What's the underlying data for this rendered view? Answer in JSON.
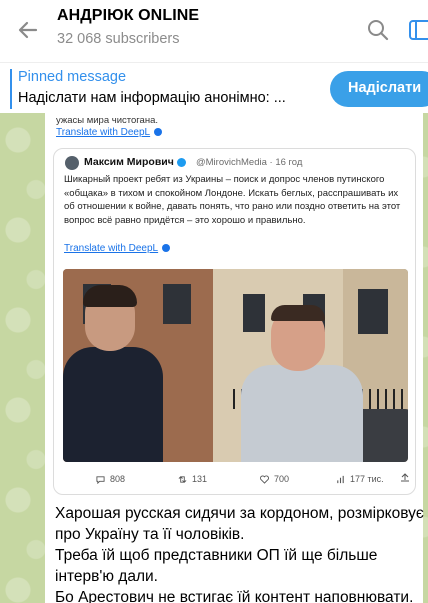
{
  "header": {
    "title": "АНДРІЮК ONLINE",
    "subscribers": "32 068 subscribers"
  },
  "pinned": {
    "label": "Pinned message",
    "text": "Надіслати нам інформацію анонімно: ...",
    "button": "Надіслати"
  },
  "post": {
    "snippet_text": "ужасы мира чистогана.",
    "snippet_translate": "Translate with DeepL",
    "tweet": {
      "author": "Максим Мирович",
      "handle_time": "@MirovichMedia · 16 год",
      "body": "Шикарный проект ребят из Украины – поиск и допрос членов путинского «общака» в тихом и спокойном Лондоне. Искать беглых, расспрашивать их об отношении к войне, давать понять, что рано или поздно ответить на этот вопрос всё равно придётся – это хорошо и правильно.",
      "translate": "Translate with DeepL",
      "stats": {
        "comments": "808",
        "retweets": "131",
        "likes": "700",
        "views": "177 тис."
      }
    },
    "message_lines": [
      "Харошая русская сидячи за кордоном, розмірковує",
      "про Україну та її чоловіків.",
      "Треба їй щоб представники ОП їй ще більше",
      "інтерв'ю дали.",
      "Бо Арестович не встигає їй контент наповнювати."
    ]
  },
  "colors": {
    "accent": "#3390ec",
    "button": "#3aa0e8",
    "chat_bg": "#c6d7a2",
    "link": "#1a73e8"
  },
  "icons": [
    "back-arrow-icon",
    "search-icon",
    "side-panel-icon",
    "verified-icon",
    "deepl-icon",
    "comment-icon",
    "retweet-icon",
    "like-icon",
    "views-icon",
    "share-icon"
  ]
}
